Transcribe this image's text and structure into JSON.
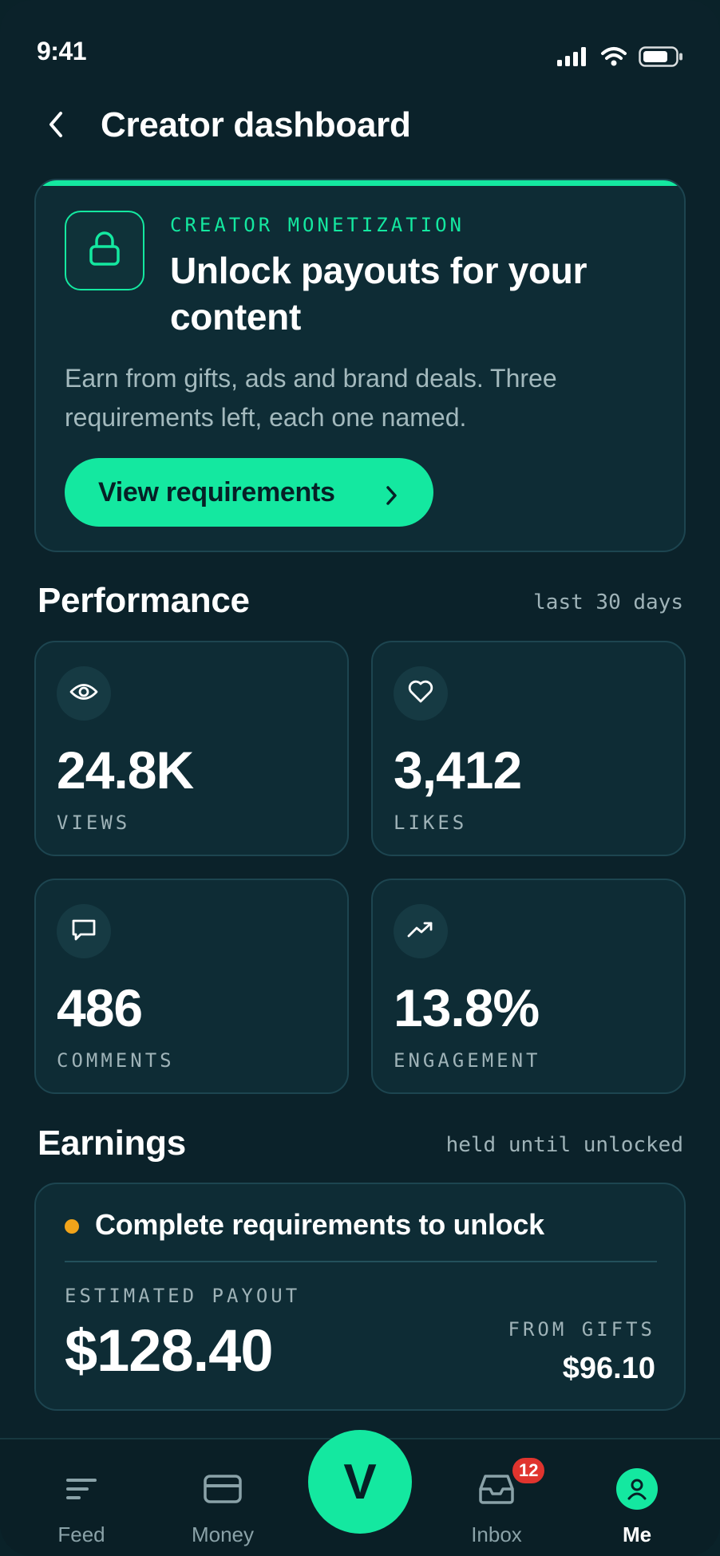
{
  "status_bar": {
    "time": "9:41"
  },
  "header": {
    "title": "Creator dashboard"
  },
  "promo": {
    "eyebrow": "CREATOR MONETIZATION",
    "title": "Unlock payouts for your content",
    "description": "Earn from gifts, ads and brand deals. Three requirements left, each one named.",
    "cta_label": "View requirements"
  },
  "performance": {
    "title": "Performance",
    "period": "last 30 days",
    "stats": [
      {
        "icon": "eye-icon",
        "value": "24.8K",
        "label": "VIEWS"
      },
      {
        "icon": "heart-icon",
        "value": "3,412",
        "label": "LIKES"
      },
      {
        "icon": "comment-icon",
        "value": "486",
        "label": "COMMENTS"
      },
      {
        "icon": "trending-up-icon",
        "value": "13.8%",
        "label": "ENGAGEMENT"
      }
    ]
  },
  "earnings": {
    "title": "Earnings",
    "note": "held until unlocked",
    "status": "Complete requirements to unlock",
    "estimated_label": "ESTIMATED PAYOUT",
    "estimated_value": "$128.40",
    "gifts_label": "FROM GIFTS",
    "gifts_value": "$96.10"
  },
  "nav": {
    "items": [
      {
        "label": "Feed",
        "icon": "feed-icon"
      },
      {
        "label": "Money",
        "icon": "card-icon"
      },
      {
        "label": "V",
        "icon": "create-button"
      },
      {
        "label": "Inbox",
        "icon": "inbox-icon",
        "badge": "12"
      },
      {
        "label": "Me",
        "icon": "profile-icon"
      }
    ]
  },
  "colors": {
    "accent": "#14e8a0",
    "background": "#0b222a",
    "card": "#0e2c35",
    "warning_dot": "#f1a41a",
    "badge": "#e0342e"
  }
}
